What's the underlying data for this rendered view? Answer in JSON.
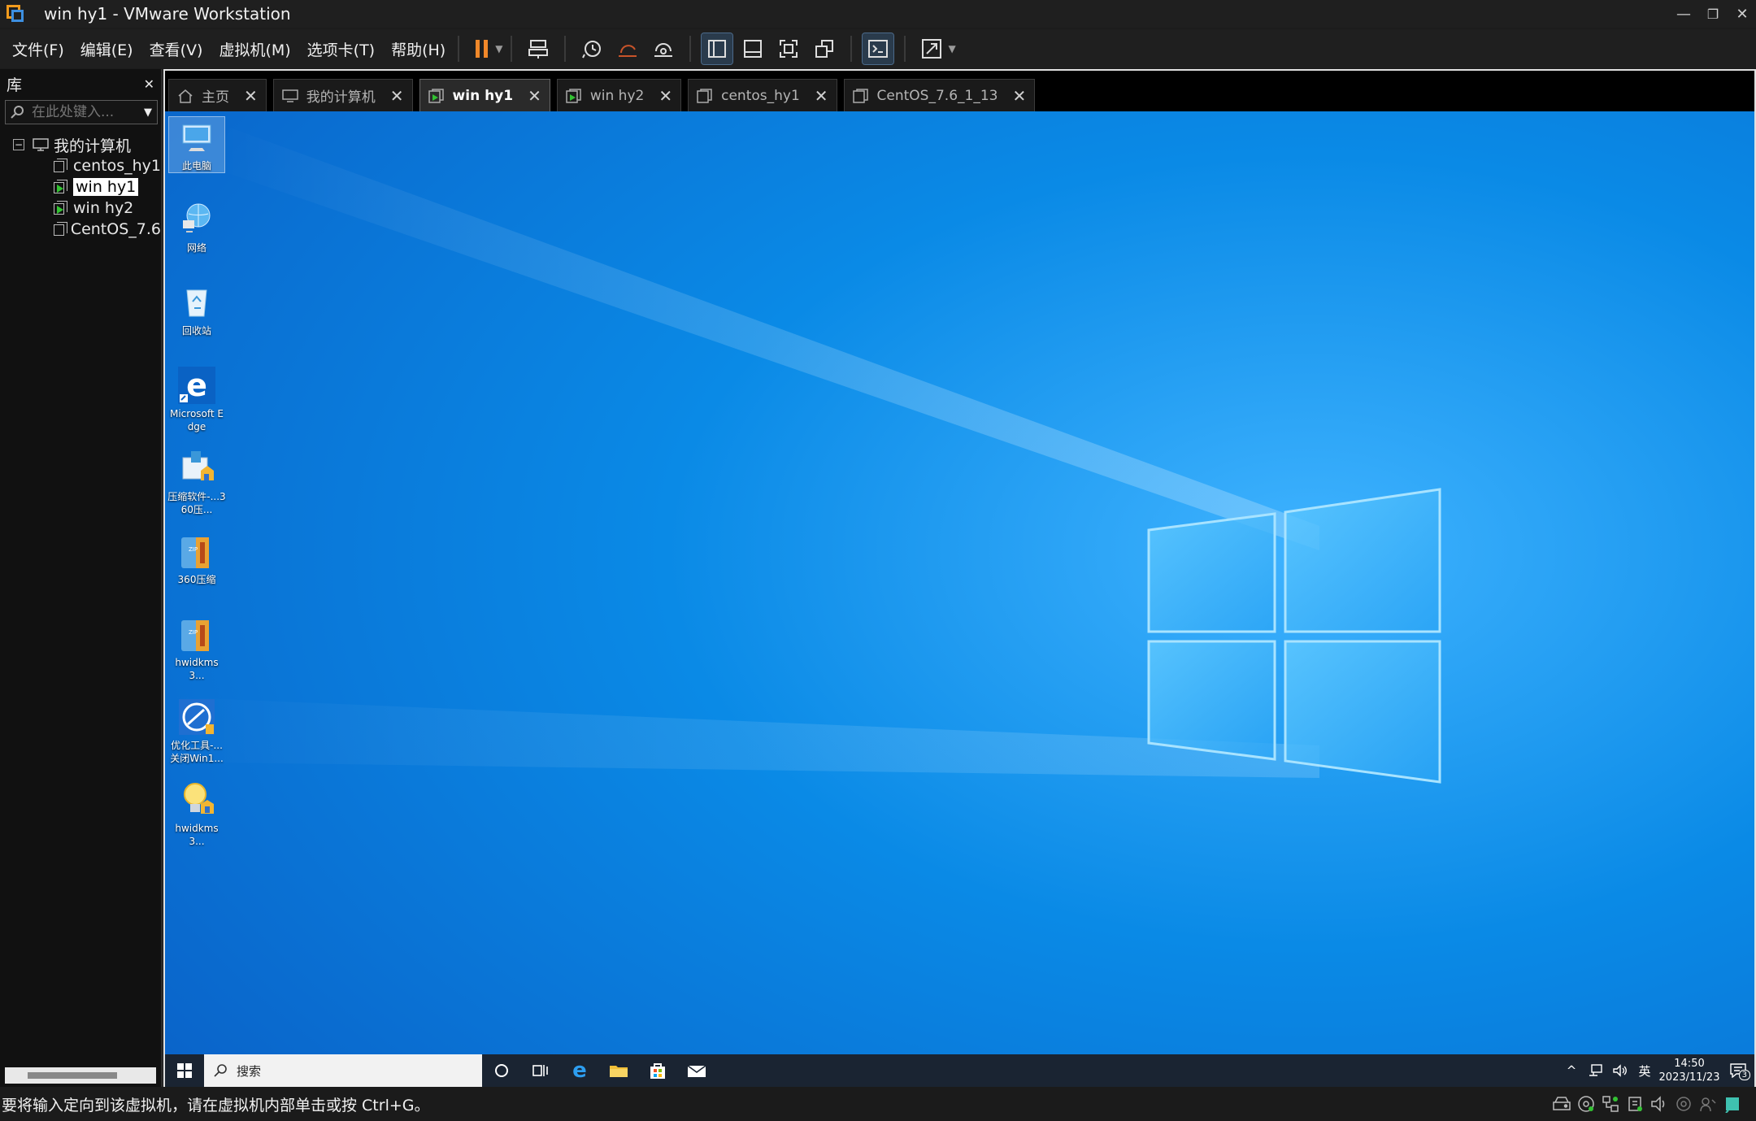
{
  "window": {
    "title": "win hy1 - VMware Workstation",
    "minimize": "—",
    "restore": "❐",
    "close": "✕"
  },
  "menu": [
    "文件(F)",
    "编辑(E)",
    "查看(V)",
    "虚拟机(M)",
    "选项卡(T)",
    "帮助(H)"
  ],
  "library": {
    "title": "库",
    "close": "✕",
    "search_placeholder": "在此处键入...",
    "root": "我的计算机",
    "items": [
      {
        "label": "centos_hy1",
        "running": false,
        "selected": false
      },
      {
        "label": "win hy1",
        "running": true,
        "selected": true
      },
      {
        "label": "win hy2",
        "running": true,
        "selected": false
      },
      {
        "label": "CentOS_7.6",
        "running": false,
        "selected": false
      }
    ]
  },
  "tabs": [
    {
      "label": "主页",
      "icon": "home-icon",
      "active": false
    },
    {
      "label": "我的计算机",
      "icon": "computer-icon",
      "active": false
    },
    {
      "label": "win hy1",
      "icon": "vm-running-icon",
      "active": true
    },
    {
      "label": "win hy2",
      "icon": "vm-running-icon",
      "active": false
    },
    {
      "label": "centos_hy1",
      "icon": "vm-icon",
      "active": false
    },
    {
      "label": "CentOS_7.6_1_13",
      "icon": "vm-icon",
      "active": false
    }
  ],
  "desktop_icons": [
    {
      "label": "此电脑",
      "icon": "this-pc-icon"
    },
    {
      "label": "网络",
      "icon": "network-icon"
    },
    {
      "label": "回收站",
      "icon": "recycle-bin-icon"
    },
    {
      "label": "Microsoft Edge",
      "icon": "edge-icon"
    },
    {
      "label": "压缩软件-...360压...",
      "icon": "installer-icon"
    },
    {
      "label": "360压缩",
      "icon": "zip-icon"
    },
    {
      "label": "hwidkms3...",
      "icon": "zip-icon"
    },
    {
      "label": "优化工具-...关闭Win1...",
      "icon": "optimize-tool-icon"
    },
    {
      "label": "hwidkms3...",
      "icon": "lightbulb-icon"
    }
  ],
  "taskbar": {
    "search_text": "搜索",
    "ime": "英",
    "time": "14:50",
    "date": "2023/11/23",
    "notifications": "3"
  },
  "statusbar": {
    "text": "要将输入定向到该虚拟机，请在虚拟机内部单击或按 Ctrl+G。"
  },
  "colors": {
    "accent_pause": "#f0882a",
    "desktop_blue": "#0a78d7",
    "running_green": "#33c233"
  }
}
